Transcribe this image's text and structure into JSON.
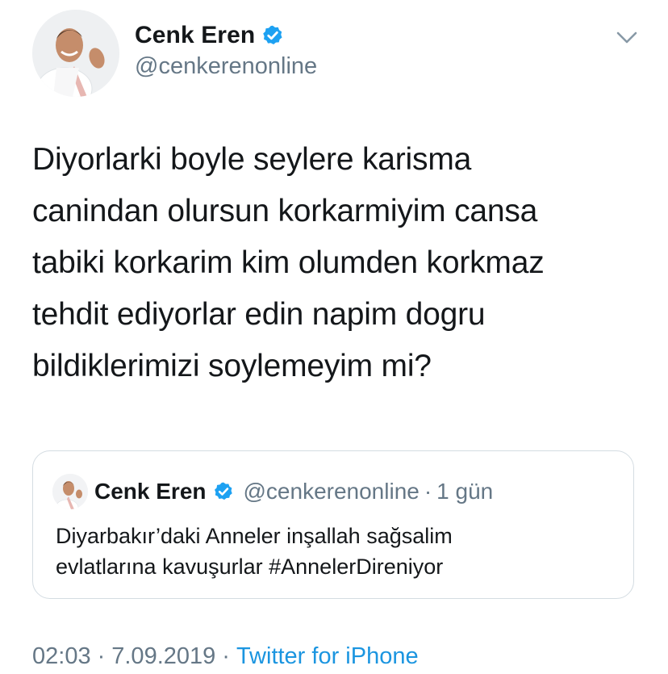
{
  "author": {
    "display_name": "Cenk Eren",
    "handle": "@cenkerenonline",
    "verified": true
  },
  "tweet": {
    "text": "Diyorlarki boyle seylere karisma\ncanindan olursun korkarmiyim cansa\ntabiki korkarim kim olumden korkmaz\ntehdit ediyorlar edin napim dogru\nbildiklerimizi soylemeyim mi?"
  },
  "quoted_tweet": {
    "display_name": "Cenk Eren",
    "handle": "@cenkerenonline",
    "separator": "·",
    "time_ago": "1 gün",
    "text": "Diyarbakır’daki Anneler inşallah sağsalim\nevlatlarına kavuşurlar #AnnelerDireniyor"
  },
  "meta": {
    "time": "02:03",
    "separator": "·",
    "date": "7.09.2019",
    "separator2": "·",
    "source": "Twitter for iPhone"
  },
  "colors": {
    "text_primary": "#14171a",
    "text_secondary": "#657786",
    "verified_blue": "#1da1f2",
    "link_blue": "#1b95e0",
    "card_border": "#d4dce2"
  },
  "icons": {
    "verified": "verified-badge-icon",
    "menu": "chevron-down-icon"
  }
}
